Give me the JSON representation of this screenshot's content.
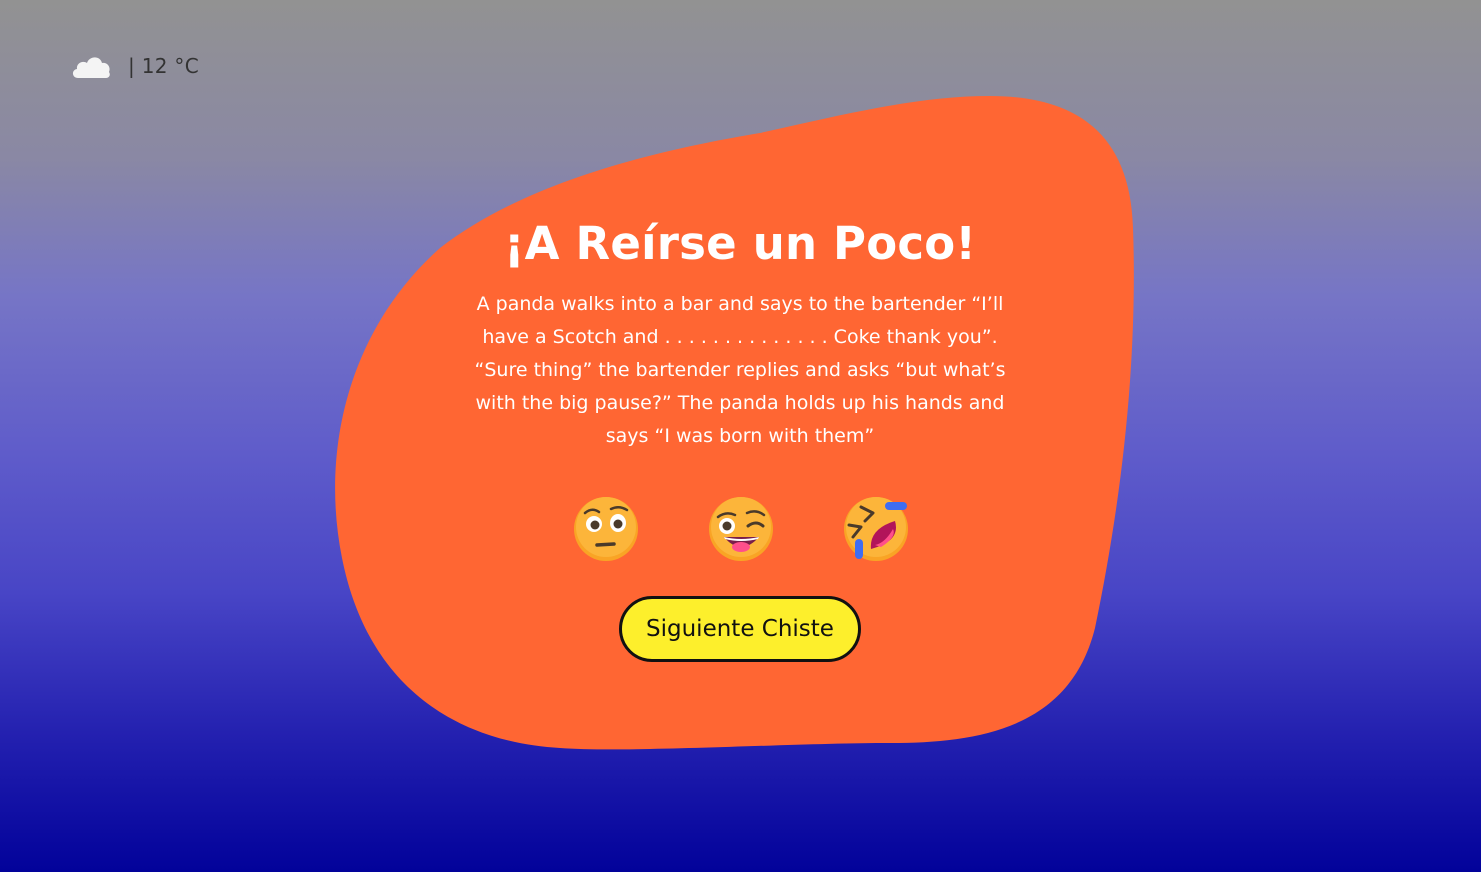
{
  "weather": {
    "icon": "cloud-icon",
    "text": "| 12 °C"
  },
  "card": {
    "title": "¡A Reírse un Poco!",
    "joke": "A panda walks into a bar and says to the bartender “I’ll have a Scotch and . . . . . . . . . . . . . . Coke thank you”. “Sure thing” the bartender replies and asks “but what’s with the big pause?” The panda holds up his hands and says “I was born with them”",
    "background_color": "#ff6633"
  },
  "reactions": [
    {
      "icon": "face-with-raised-eyebrow-icon"
    },
    {
      "icon": "winking-face-with-tongue-icon"
    },
    {
      "icon": "rolling-on-floor-laughing-icon"
    }
  ],
  "next_button": {
    "label": "Siguiente Chiste",
    "color": "#fdef2c"
  }
}
